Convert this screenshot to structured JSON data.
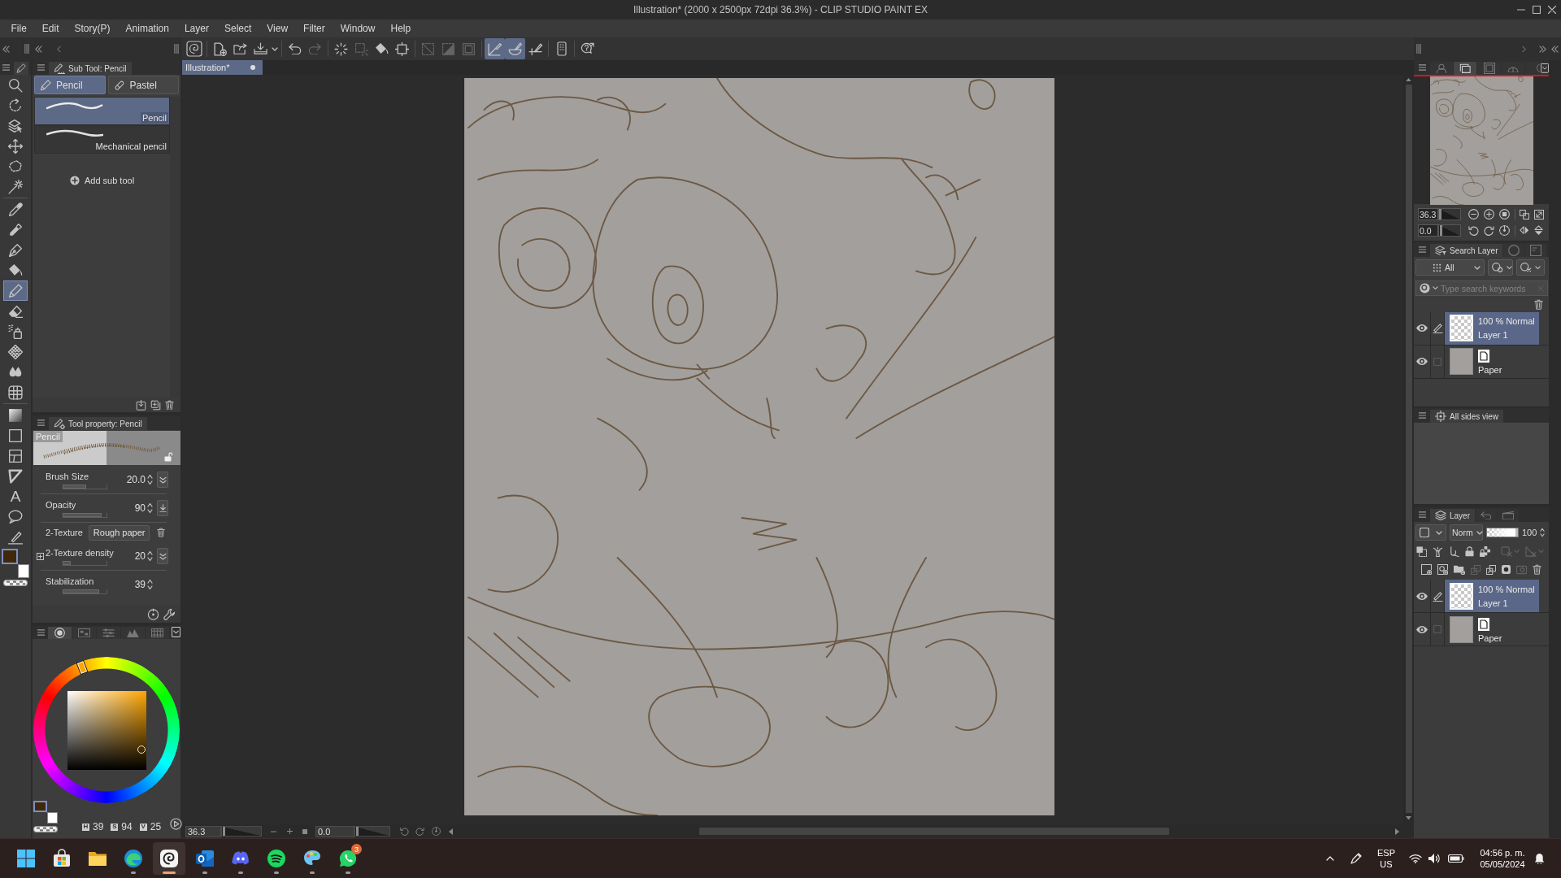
{
  "window": {
    "title": "Illustration* (2000 x 2500px 72dpi 36.3%) - CLIP STUDIO PAINT EX"
  },
  "menu": [
    "File",
    "Edit",
    "Story(P)",
    "Animation",
    "Layer",
    "Select",
    "View",
    "Filter",
    "Window",
    "Help"
  ],
  "command_bar": [
    {
      "on": false,
      "disabled": false
    },
    {
      "on": false,
      "disabled": false
    },
    {
      "on": false,
      "disabled": false
    },
    {
      "on": false,
      "disabled": false
    },
    {
      "on": false,
      "disabled": false
    },
    {
      "on": false,
      "disabled": true
    },
    {
      "on": false,
      "disabled": false
    },
    {
      "on": false,
      "disabled": true
    },
    {
      "on": false,
      "disabled": false
    },
    {
      "on": false,
      "disabled": false
    },
    {
      "on": false,
      "disabled": true
    },
    {
      "on": false,
      "disabled": true
    },
    {
      "on": false,
      "disabled": true
    },
    {
      "on": true,
      "disabled": false
    },
    {
      "on": true,
      "disabled": false
    },
    {
      "on": false,
      "disabled": false
    },
    {
      "on": false,
      "disabled": false
    },
    {
      "on": false,
      "disabled": false
    }
  ],
  "tools": [
    {
      "selected": false
    },
    {
      "selected": false
    },
    {
      "selected": false
    },
    {
      "selected": false
    },
    {
      "selected": false
    },
    {
      "selected": false
    },
    {
      "selected": false
    },
    {
      "selected": false
    },
    {
      "selected": false
    },
    {
      "selected": false
    },
    {
      "selected": true
    },
    {
      "selected": false
    },
    {
      "selected": false
    },
    {
      "selected": false
    },
    {
      "selected": false
    },
    {
      "selected": false
    },
    {
      "selected": false
    },
    {
      "selected": false
    },
    {
      "selected": false
    },
    {
      "selected": false
    },
    {
      "selected": false,
      "glyph": "A"
    },
    {
      "selected": false
    },
    {
      "selected": false
    }
  ],
  "tool_colors": [
    {
      "color": "#40290a",
      "selected": true
    },
    {
      "color": "#ffffff",
      "selected": false
    }
  ],
  "sub_tool": {
    "title": "Sub Tool: Pencil",
    "groups": [
      {
        "label": "Pencil",
        "selected": true
      },
      {
        "label": "Pastel",
        "selected": false
      }
    ],
    "items": [
      {
        "label": "Pencil",
        "selected": true
      },
      {
        "label": "Mechanical pencil",
        "selected": false
      }
    ],
    "add_label": "Add sub tool"
  },
  "tool_property": {
    "title": "Tool property: Pencil",
    "preview_label": "Pencil",
    "properties": [
      {
        "kind": "slider",
        "label": "Brush Size",
        "value": "20.0",
        "level": 0.53
      },
      {
        "kind": "slider",
        "label": "Opacity",
        "value": "90",
        "level": 0.89
      },
      {
        "kind": "choice",
        "label": "2-Texture",
        "value": "Rough paper"
      },
      {
        "kind": "slider",
        "label": "2-Texture density",
        "value": "20",
        "level": 0.18,
        "expanded": false
      },
      {
        "kind": "slider",
        "label": "Stabilization",
        "value": "39",
        "level": 0.83
      }
    ]
  },
  "color_panel": {
    "tabs": [
      {
        "selected": true
      },
      {
        "selected": false
      },
      {
        "selected": false
      },
      {
        "selected": false
      },
      {
        "selected": false
      }
    ],
    "swatches": [
      {
        "color": "#40290a",
        "selected": true
      },
      {
        "color": "#ffffff",
        "selected": false
      }
    ],
    "readouts": [
      {
        "label": "H",
        "value": "39"
      },
      {
        "label": "S",
        "value": "94"
      },
      {
        "label": "V",
        "value": "25"
      }
    ]
  },
  "document_tabs": [
    {
      "label": "Illustration*",
      "selected": true,
      "modified": true
    }
  ],
  "status_bar": {
    "zoom": "36.3",
    "zoom_slider": {
      "level": 0.02
    },
    "rotation": "0.0",
    "rotation_slider": {
      "level": 0.02
    }
  },
  "navigator": {
    "tabs": [
      {
        "selected": false
      },
      {
        "selected": true
      },
      {
        "selected": false
      },
      {
        "selected": false
      },
      {
        "selected": false
      }
    ],
    "zoom": "36.3",
    "zoom_slider": {
      "level": 0.02
    },
    "rotation": "0.0",
    "rotation_slider": {
      "level": 0.05
    }
  },
  "search_layer": {
    "tabs": [
      {
        "label": "Search Layer",
        "selected": true
      },
      {
        "selected": false
      },
      {
        "selected": false
      }
    ],
    "filter": "All",
    "search": {
      "placeholder": "Type search keywords"
    },
    "layers": [
      {
        "kind": "raster",
        "info": "100 % Normal",
        "name": "Layer 1",
        "selected": true,
        "visible": true,
        "editing": true
      },
      {
        "kind": "paper",
        "name": "Paper",
        "selected": false,
        "visible": true,
        "editing": false
      }
    ]
  },
  "all_sides_view": {
    "title": "All sides view"
  },
  "layer_panel": {
    "tabs": [
      {
        "label": "Layer",
        "selected": true
      },
      {
        "selected": false
      },
      {
        "selected": false
      }
    ],
    "blend_mode": "Norm",
    "opacity_slider": {
      "level": 1
    },
    "opacity": "100",
    "layers": [
      {
        "kind": "raster",
        "info": "100 % Normal",
        "name": "Layer 1",
        "selected": true,
        "visible": true,
        "editing": true
      },
      {
        "kind": "paper",
        "name": "Paper",
        "selected": false,
        "visible": true,
        "editing": false
      }
    ]
  },
  "taskbar": {
    "apps": [
      {
        "running": false,
        "selected": false
      },
      {
        "running": false,
        "selected": false
      },
      {
        "running": false,
        "selected": false
      },
      {
        "running": true,
        "selected": false
      },
      {
        "running": true,
        "selected": true
      },
      {
        "running": true,
        "selected": false
      },
      {
        "running": true,
        "selected": false
      },
      {
        "running": true,
        "selected": false
      },
      {
        "running": true,
        "selected": false
      },
      {
        "running": true,
        "selected": false,
        "badge": "3"
      }
    ],
    "language": "ESP",
    "region": "US",
    "time": "04:56 p. m.",
    "date": "05/05/2024"
  }
}
